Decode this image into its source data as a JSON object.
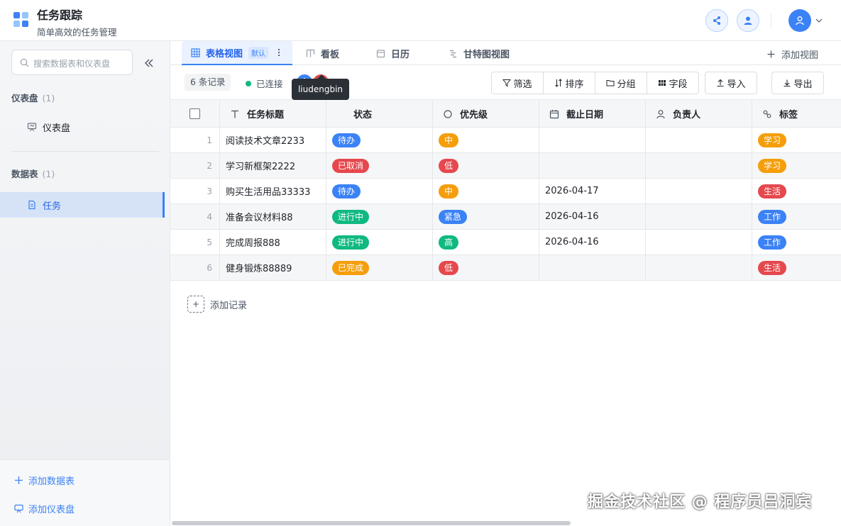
{
  "app": {
    "title": "任务跟踪",
    "subtitle": "简单高效的任务管理"
  },
  "sidebar": {
    "search_placeholder": "搜索数据表和仪表盘",
    "dashboards": {
      "title": "仪表盘",
      "count": "(1)",
      "items": [
        "仪表盘"
      ]
    },
    "tables": {
      "title": "数据表",
      "count": "(1)",
      "items": [
        "任务"
      ]
    },
    "add_table": "添加数据表",
    "add_dashboard": "添加仪表盘"
  },
  "tabs": [
    {
      "label": "表格视图",
      "badge": "默认"
    },
    {
      "label": "看板"
    },
    {
      "label": "日历"
    },
    {
      "label": "甘特图视图"
    }
  ],
  "add_view": "添加视图",
  "toolbar": {
    "records": "6 条记录",
    "status": "已连接",
    "avatars": [
      "A",
      "L"
    ],
    "tooltip": "liudengbin",
    "filter": "筛选",
    "sort": "排序",
    "group": "分组",
    "fields": "字段",
    "import": "导入",
    "export": "导出"
  },
  "columns": [
    "任务标题",
    "状态",
    "优先级",
    "截止日期",
    "负责人",
    "标签"
  ],
  "rows": [
    {
      "n": "1",
      "title": "阅读技术文章2233",
      "status": "待办",
      "priority": "中",
      "due": "",
      "owner": "",
      "tag": "学习"
    },
    {
      "n": "2",
      "title": "学习新框架2222",
      "status": "已取消",
      "priority": "低",
      "due": "",
      "owner": "",
      "tag": "学习"
    },
    {
      "n": "3",
      "title": "购买生活用品33333",
      "status": "待办",
      "priority": "中",
      "due": "2026-04-17",
      "owner": "",
      "tag": "生活"
    },
    {
      "n": "4",
      "title": "准备会议材料88",
      "status": "进行中",
      "priority": "紧急",
      "due": "2026-04-16",
      "owner": "",
      "tag": "工作"
    },
    {
      "n": "5",
      "title": "完成周报888",
      "status": "进行中",
      "priority": "高",
      "due": "2026-04-16",
      "owner": "",
      "tag": "工作"
    },
    {
      "n": "6",
      "title": "健身锻炼88889",
      "status": "已完成",
      "priority": "低",
      "due": "",
      "owner": "",
      "tag": "生活"
    }
  ],
  "colors": {
    "待办": "#3b82f6",
    "已取消": "#e5484d",
    "进行中": "#10b981",
    "已完成": "#f59e0b",
    "中": "#f59e0b",
    "低": "#e5484d",
    "紧急": "#3b82f6",
    "高": "#10b981",
    "学习": "#f59e0b",
    "生活": "#e5484d",
    "工作": "#3b82f6",
    "accent": "#3b82f6"
  },
  "add_record": "添加记录",
  "watermark": "掘金技术社区 @ 程序员吕洞宾"
}
